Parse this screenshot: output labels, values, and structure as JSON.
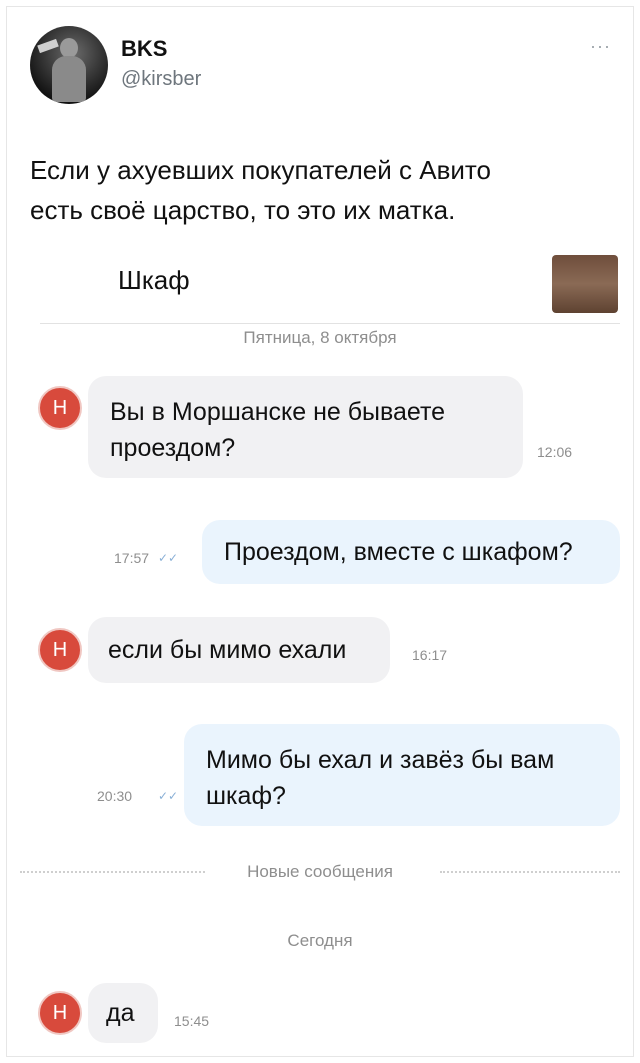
{
  "tweet": {
    "author_name": "BKS",
    "author_handle": "@kirsber",
    "more_icon": "more-dots-icon",
    "text_line1": "Если у ахуевших покупателей с Авито",
    "text_line2": "есть своё царство, то это их матка."
  },
  "chat": {
    "title": "Шкаф",
    "date_label": "Пятница, 8 октября",
    "avatar_letter": "Н",
    "messages": [
      {
        "direction": "in",
        "line1": "Вы в Моршанске не бываете",
        "line2": "проездом?",
        "time": "12:06"
      },
      {
        "direction": "out",
        "line1": "Проездом, вместе с шкафом?",
        "time": "17:57",
        "status_icon": "double-check-icon"
      },
      {
        "direction": "in",
        "line1": "если бы мимо ехали",
        "time": "16:17"
      },
      {
        "direction": "out",
        "line1": "Мимо бы ехал и завёз бы вам",
        "line2": "шкаф?",
        "time": "20:30",
        "status_icon": "double-check-icon"
      },
      {
        "direction": "in",
        "line1": "да",
        "time": "15:45"
      }
    ],
    "new_messages_label": "Новые сообщения",
    "today_label": "Сегодня",
    "colors": {
      "avatar_red": "#d84a3c",
      "incoming_bubble": "#f1f1f3",
      "outgoing_bubble": "#eaf4fd"
    }
  }
}
